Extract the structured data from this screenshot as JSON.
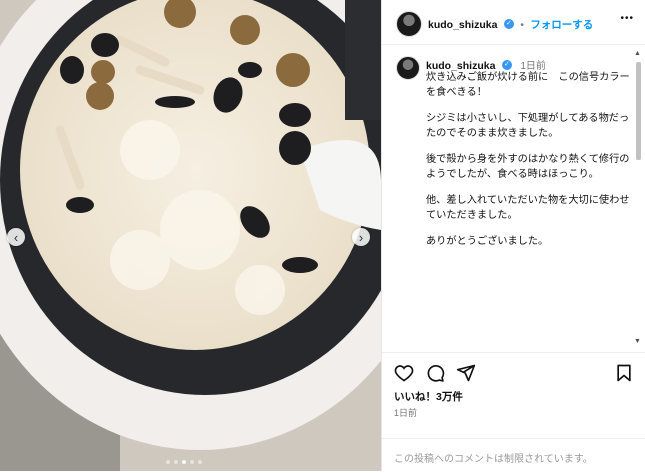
{
  "post": {
    "username": "kudo_shizuka",
    "follow_sep": "•",
    "follow_label": "フォローする",
    "more_label": "•••",
    "caption_time": "1日前",
    "caption": [
      "炊き込みご飯が炊ける前に　この信号カラーを食べきる！",
      "シジミは小さいし、下処理がしてある物だったのでそのまま炊きました。",
      "後で殻から身を外すのはかなり熱くて修行のようでしたが、食べる時はほっこり。",
      "他、差し入れていただいた物を大切に使わせていただきました。",
      "ありがとうございました。"
    ],
    "likes": "いいね！3万件",
    "timestamp": "1日前",
    "comment_placeholder": "この投稿へのコメントは制限されています。"
  },
  "carousel": {
    "dot_count": 5,
    "active_index": 2
  },
  "icons": [
    "heart-icon",
    "comment-icon",
    "share-icon",
    "bookmark-icon",
    "verified-icon",
    "prev-arrow-icon",
    "next-arrow-icon"
  ],
  "colors": {
    "accent": "#0095f6",
    "verified": "#3897f0"
  }
}
